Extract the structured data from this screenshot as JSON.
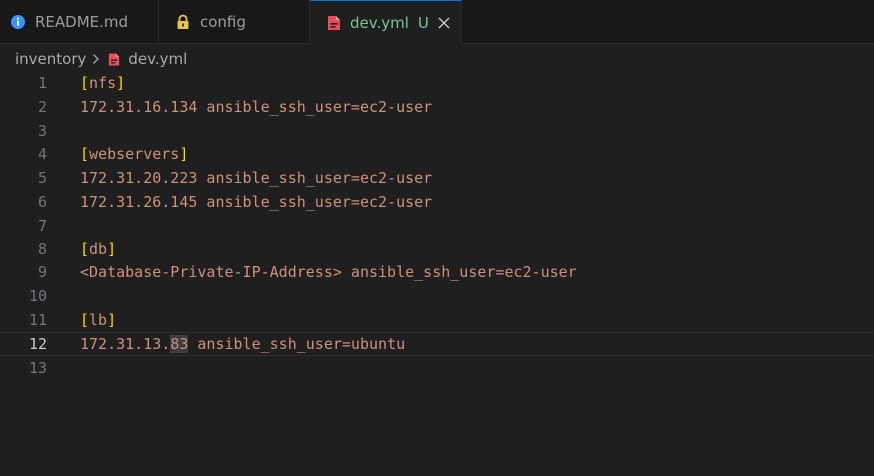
{
  "tabs": [
    {
      "label": "README.md",
      "icon": "info-icon"
    },
    {
      "label": "config",
      "icon": "lock-icon"
    },
    {
      "label": "dev.yml",
      "icon": "yaml-file-icon",
      "status": "U",
      "active": true
    }
  ],
  "breadcrumb": {
    "folder": "inventory",
    "file": "dev.yml"
  },
  "editor": {
    "current_line": 12,
    "lines": [
      {
        "num": "1",
        "open": "[",
        "text": "nfs",
        "close": "]"
      },
      {
        "num": "2",
        "text": "172.31.16.134 ansible_ssh_user=ec2-user"
      },
      {
        "num": "3",
        "text": ""
      },
      {
        "num": "4",
        "open": "[",
        "text": "webservers",
        "close": "]"
      },
      {
        "num": "5",
        "text": "172.31.20.223 ansible_ssh_user=ec2-user"
      },
      {
        "num": "6",
        "text": "172.31.26.145 ansible_ssh_user=ec2-user"
      },
      {
        "num": "7",
        "text": ""
      },
      {
        "num": "8",
        "open": "[",
        "text": "db",
        "close": "]"
      },
      {
        "num": "9",
        "text": "<Database-Private-IP-Address> ansible_ssh_user=ec2-user"
      },
      {
        "num": "10",
        "text": ""
      },
      {
        "num": "11",
        "open": "[",
        "text": "lb",
        "close": "]"
      },
      {
        "num": "12",
        "pre": "172.31.13.",
        "selected": "83",
        "post": " ansible_ssh_user=ubuntu"
      },
      {
        "num": "13",
        "text": ""
      }
    ]
  },
  "colors": {
    "background": "#1f1f1f",
    "string": "#ce9178",
    "bracket": "#ffd700",
    "untracked": "#73c991",
    "accent": "#0078d4"
  }
}
